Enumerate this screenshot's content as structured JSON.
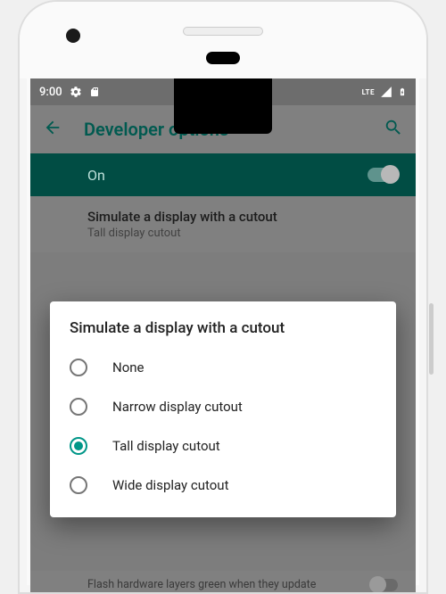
{
  "status": {
    "time": "9:00",
    "network_label": "LTE"
  },
  "appbar": {
    "title": "Developer options"
  },
  "master_toggle": {
    "label": "On",
    "value": true
  },
  "setting": {
    "title": "Simulate a display with a cutout",
    "subtitle": "Tall display cutout"
  },
  "dialog": {
    "title": "Simulate a display with a cutout",
    "selected_index": 2,
    "options": [
      {
        "label": "None"
      },
      {
        "label": "Narrow display cutout"
      },
      {
        "label": "Tall display cutout"
      },
      {
        "label": "Wide display cutout"
      }
    ]
  },
  "bg_setting": {
    "text": "Flash hardware layers green when they update"
  },
  "colors": {
    "accent": "#009688",
    "appbar_text": "#015a50",
    "toggle_bg": "#014d44"
  }
}
